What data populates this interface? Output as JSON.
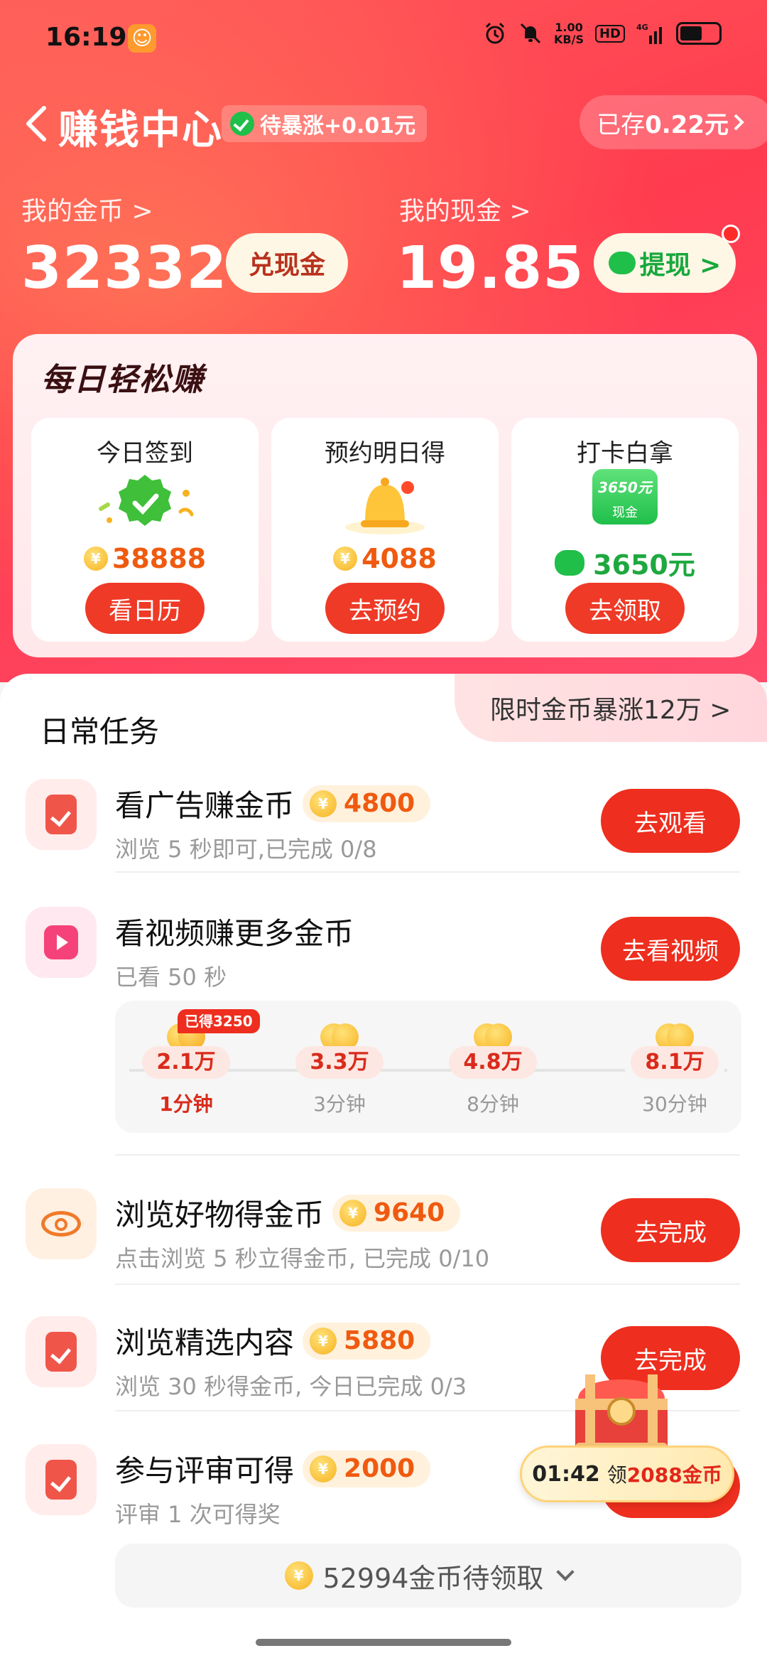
{
  "status_bar": {
    "time": "16:19",
    "net_speed": "1.00",
    "net_unit": "KB/S",
    "hd": "HD",
    "signal": "4G"
  },
  "header": {
    "back_icon": "chevron-left-icon",
    "title": "赚钱中心",
    "surge_badge": "待暴涨+0.01元",
    "saved_prefix": "已存",
    "saved_amount": "0.22元"
  },
  "balance": {
    "coins_label": "我的金币 >",
    "coins_value": "32332",
    "exchange_button": "兑现金",
    "cash_label": "我的现金 >",
    "cash_value": "19.85",
    "withdraw_button": "提现 >"
  },
  "daily": {
    "title": "每日轻松赚",
    "tiles": [
      {
        "title": "今日签到",
        "amount": "38888",
        "button": "看日历"
      },
      {
        "title": "预约明日得",
        "amount": "4088",
        "button": "去预约"
      },
      {
        "title": "打卡白拿",
        "amount": "3650元",
        "button": "去领取",
        "art_amount": "3650元",
        "art_label": "现金"
      }
    ]
  },
  "tasks": {
    "title": "日常任务",
    "promo": "限时金币暴涨12万 >",
    "items": [
      {
        "title": "看广告赚金币",
        "reward": "4800",
        "subtitle": "浏览 5 秒即可,已完成 0/8",
        "button": "去观看"
      },
      {
        "title": "看视频赚更多金币",
        "reward": "",
        "subtitle": "已看 50 秒",
        "button": "去看视频"
      },
      {
        "title": "浏览好物得金币",
        "reward": "9640",
        "subtitle": "点击浏览 5 秒立得金币, 已完成 0/10",
        "button": "去完成"
      },
      {
        "title": "浏览精选内容",
        "reward": "5880",
        "subtitle": "浏览 30 秒得金币, 今日已完成 0/3",
        "button": "去完成"
      },
      {
        "title": "参与评审可得",
        "reward": "2000",
        "subtitle": "评审 1 次可得奖",
        "button": ""
      }
    ],
    "video_milestones": [
      {
        "amount": "2.1万",
        "time": "1分钟",
        "done": true
      },
      {
        "amount": "3.3万",
        "time": "3分钟",
        "done": false
      },
      {
        "amount": "4.8万",
        "time": "8分钟",
        "done": false
      },
      {
        "amount": "8.1万",
        "time": "30分钟",
        "done": false
      }
    ],
    "earned_tag": "已得3250"
  },
  "floating": {
    "timer": "01:42",
    "claim_prefix": "领",
    "claim_amount": "2088金币"
  },
  "pending": {
    "text": "52994金币待领取"
  },
  "colors": {
    "accent_red": "#ee2e1e",
    "coin_orange": "#ef5a10",
    "wechat_green": "#1fbf4a"
  }
}
